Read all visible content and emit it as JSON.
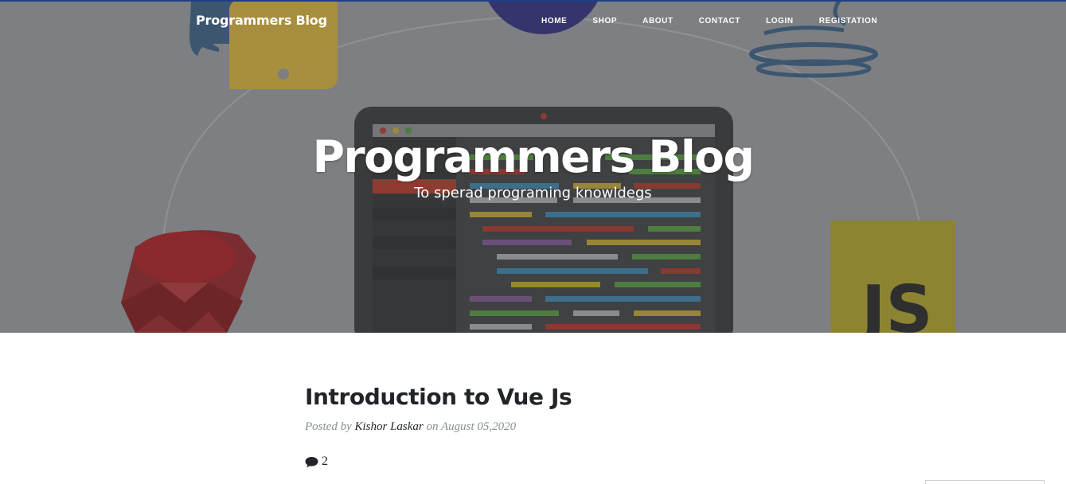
{
  "brand": "Programmers Blog",
  "nav": [
    "HOME",
    "SHOP",
    "ABOUT",
    "CONTACT",
    "LOGIN",
    "REGISTATION"
  ],
  "hero": {
    "title": "Programmers Blog",
    "subtitle": "To sperad programing knowldegs"
  },
  "post": {
    "title": "Introduction to Vue Js",
    "posted_by": "Posted by",
    "author": "Kishor Laskar",
    "on": "on",
    "date": "August 05,2020",
    "comment_count": "2"
  },
  "colors": {
    "overlay": "#7d7f82",
    "top_border": "#1f3f86",
    "text_dark": "#212529",
    "meta_gray": "#868e96"
  },
  "icons": [
    "python-logo",
    "java-logo",
    "ruby-logo",
    "javascript-logo",
    "laptop-code-illustration",
    "comment-icon"
  ]
}
